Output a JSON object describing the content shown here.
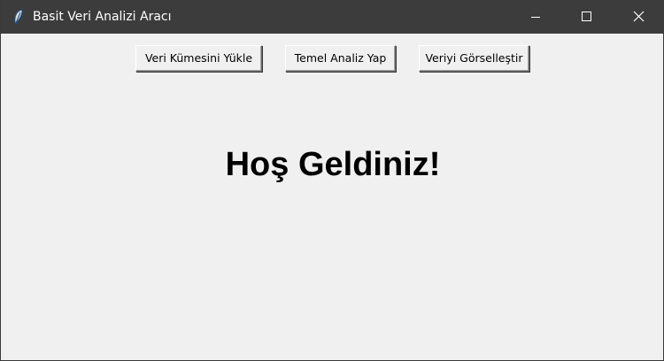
{
  "window": {
    "title": "Basit Veri Analizi Aracı",
    "icon": "feather-icon",
    "controls": {
      "minimize_icon": "minimize-icon",
      "maximize_icon": "maximize-icon",
      "close_icon": "close-icon"
    }
  },
  "toolbar": {
    "load_label": "Veri Kümesini Yükle",
    "analyze_label": "Temel Analiz Yap",
    "visualize_label": "Veriyi Görselleştir"
  },
  "main": {
    "welcome_text": "Hoş Geldiniz!"
  },
  "colors": {
    "titlebar": "#3c3c3c",
    "background": "#f0f0f0",
    "text": "#000000"
  }
}
